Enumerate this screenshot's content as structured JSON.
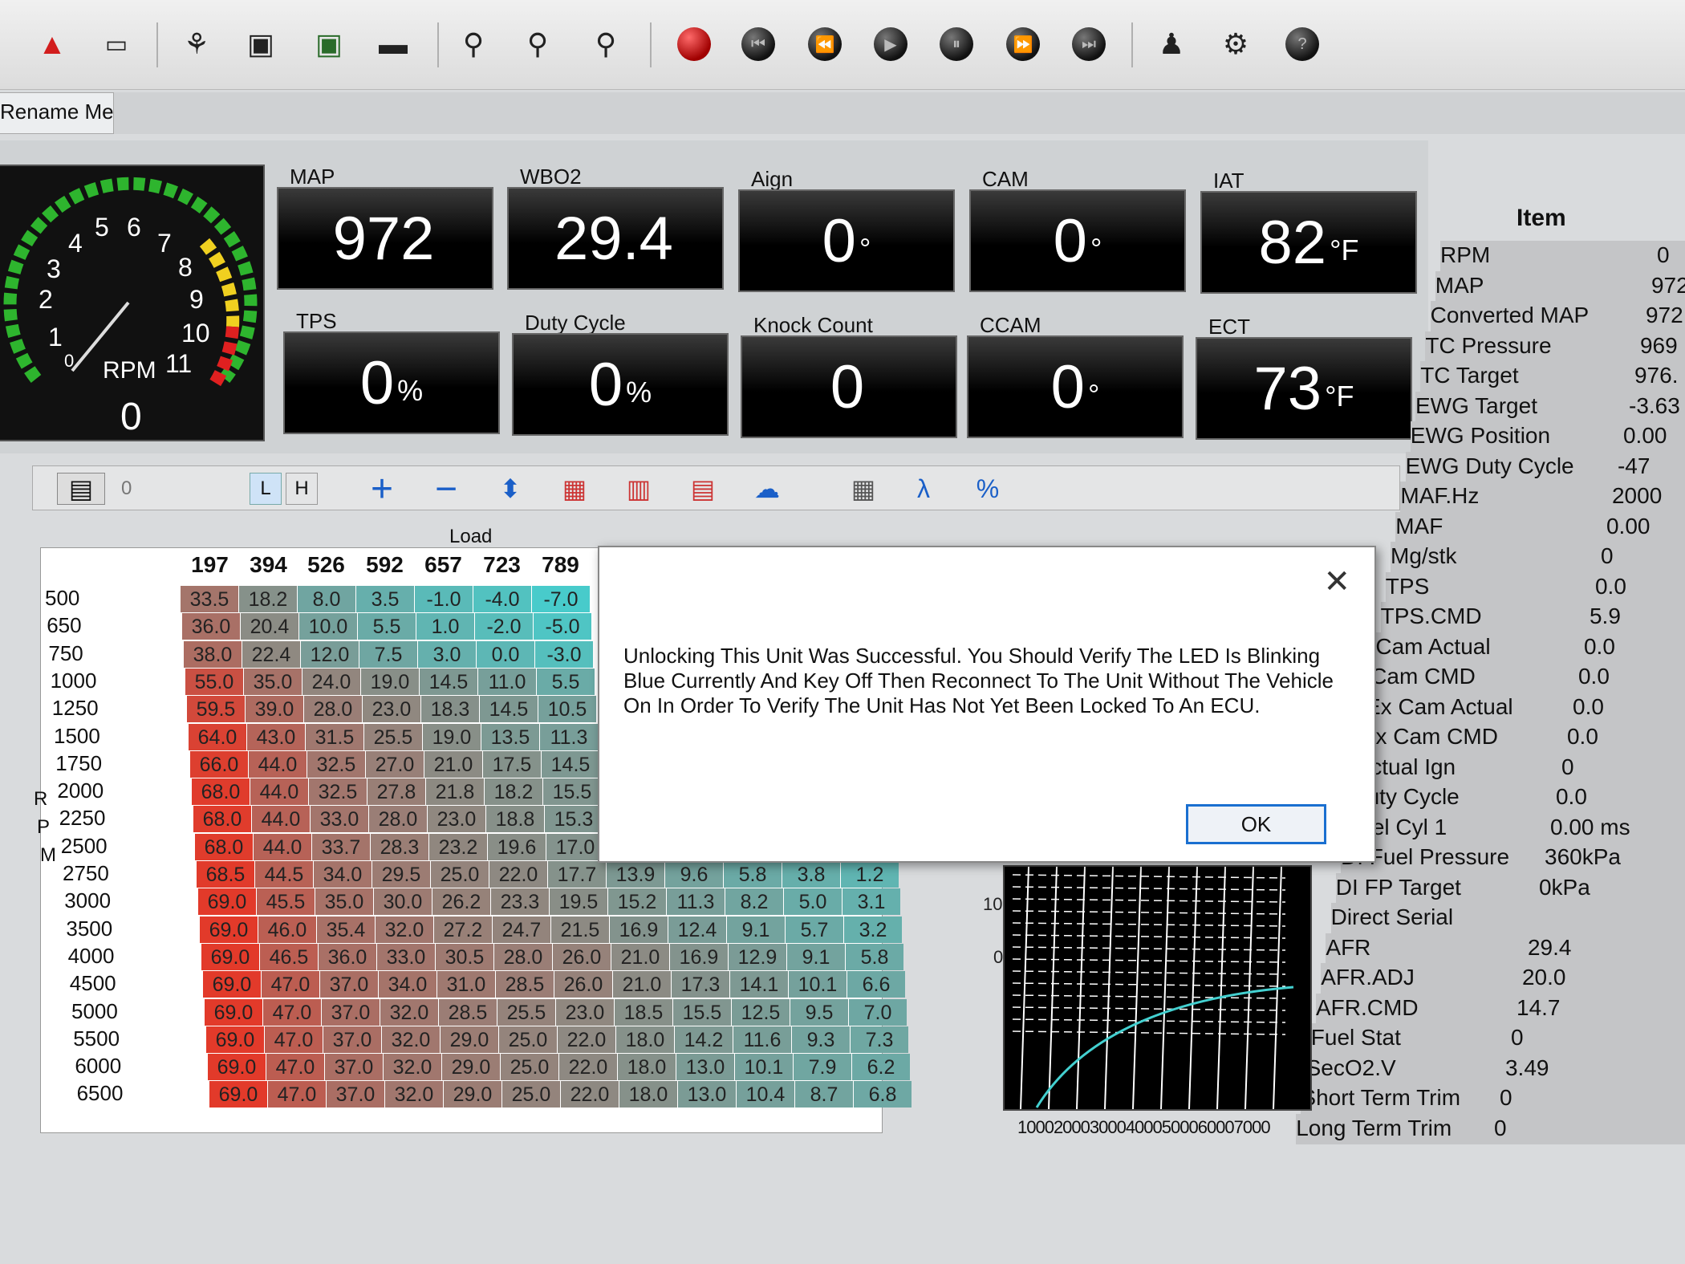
{
  "tab": {
    "label": "Rename Me"
  },
  "gauge": {
    "label": "RPM",
    "value": "0",
    "ticks": [
      "0",
      "1",
      "2",
      "3",
      "4",
      "5",
      "6",
      "7",
      "8",
      "9",
      "10",
      "11"
    ]
  },
  "panels": [
    {
      "id": "map",
      "label": "MAP",
      "value": "972",
      "unit": ""
    },
    {
      "id": "wbo2",
      "label": "WBO2",
      "value": "29.4",
      "unit": ""
    },
    {
      "id": "aign",
      "label": "Aign",
      "value": "0",
      "unit": "°"
    },
    {
      "id": "cam",
      "label": "CAM",
      "value": "0",
      "unit": "°"
    },
    {
      "id": "iat",
      "label": "IAT",
      "value": "82",
      "unit": "°F"
    },
    {
      "id": "tps",
      "label": "TPS",
      "value": "0",
      "unit": "%"
    },
    {
      "id": "duty",
      "label": "Duty Cycle",
      "value": "0",
      "unit": "%"
    },
    {
      "id": "knock",
      "label": "Knock Count",
      "value": "0",
      "unit": ""
    },
    {
      "id": "ccam",
      "label": "CCAM",
      "value": "0",
      "unit": "°"
    },
    {
      "id": "ect",
      "label": "ECT",
      "value": "73",
      "unit": "°F"
    }
  ],
  "table_toolbar": {
    "value": "0",
    "l_label": "L",
    "h_label": "H"
  },
  "table": {
    "load_label": "Load",
    "axis_label": [
      "R",
      "P",
      "M"
    ],
    "load_headers": [
      "197",
      "394",
      "526",
      "592",
      "657",
      "723",
      "789"
    ],
    "rpm": [
      "500",
      "650",
      "750",
      "1000",
      "1250",
      "1500",
      "1750",
      "2000",
      "2250",
      "2500",
      "2750",
      "3000",
      "3500",
      "4000",
      "4500",
      "5000",
      "5500",
      "6000",
      "6500"
    ],
    "rows": [
      [
        "33.5",
        "18.2",
        "8.0",
        "3.5",
        "-1.0",
        "-4.0",
        "-7.0"
      ],
      [
        "36.0",
        "20.4",
        "10.0",
        "5.5",
        "1.0",
        "-2.0",
        "-5.0"
      ],
      [
        "38.0",
        "22.4",
        "12.0",
        "7.5",
        "3.0",
        "0.0",
        "-3.0"
      ],
      [
        "55.0",
        "35.0",
        "24.0",
        "19.0",
        "14.5",
        "11.0",
        "5.5"
      ],
      [
        "59.5",
        "39.0",
        "28.0",
        "23.0",
        "18.3",
        "14.5",
        "10.5"
      ],
      [
        "64.0",
        "43.0",
        "31.5",
        "25.5",
        "19.0",
        "13.5",
        "11.3"
      ],
      [
        "66.0",
        "44.0",
        "32.5",
        "27.0",
        "21.0",
        "17.5",
        "14.5"
      ],
      [
        "68.0",
        "44.0",
        "32.5",
        "27.8",
        "21.8",
        "18.2",
        "15.5"
      ],
      [
        "68.0",
        "44.0",
        "33.0",
        "28.0",
        "23.0",
        "18.8",
        "15.3"
      ],
      [
        "68.0",
        "44.0",
        "33.7",
        "28.3",
        "23.2",
        "19.6",
        "17.0"
      ],
      [
        "68.5",
        "44.5",
        "34.0",
        "29.5",
        "25.0",
        "22.0",
        "17.7",
        "13.9",
        "9.6",
        "5.8",
        "3.8",
        "1.2"
      ],
      [
        "69.0",
        "45.5",
        "35.0",
        "30.0",
        "26.2",
        "23.3",
        "19.5",
        "15.2",
        "11.3",
        "8.2",
        "5.0",
        "3.1"
      ],
      [
        "69.0",
        "46.0",
        "35.4",
        "32.0",
        "27.2",
        "24.7",
        "21.5",
        "16.9",
        "12.4",
        "9.1",
        "5.7",
        "3.2"
      ],
      [
        "69.0",
        "46.5",
        "36.0",
        "33.0",
        "30.5",
        "28.0",
        "26.0",
        "21.0",
        "16.9",
        "12.9",
        "9.1",
        "5.8"
      ],
      [
        "69.0",
        "47.0",
        "37.0",
        "34.0",
        "31.0",
        "28.5",
        "26.0",
        "21.0",
        "17.3",
        "14.1",
        "10.1",
        "6.6"
      ],
      [
        "69.0",
        "47.0",
        "37.0",
        "32.0",
        "28.5",
        "25.5",
        "23.0",
        "18.5",
        "15.5",
        "12.5",
        "9.5",
        "7.0"
      ],
      [
        "69.0",
        "47.0",
        "37.0",
        "32.0",
        "29.0",
        "25.0",
        "22.0",
        "18.0",
        "14.2",
        "11.6",
        "9.3",
        "7.3"
      ],
      [
        "69.0",
        "47.0",
        "37.0",
        "32.0",
        "29.0",
        "25.0",
        "22.0",
        "18.0",
        "13.0",
        "10.1",
        "7.9",
        "6.2"
      ],
      [
        "69.0",
        "47.0",
        "37.0",
        "32.0",
        "29.0",
        "25.0",
        "22.0",
        "18.0",
        "13.0",
        "10.4",
        "8.7",
        "6.8"
      ]
    ]
  },
  "dialog": {
    "message": "Unlocking This Unit Was Successful. You Should Verify The LED Is Blinking Blue Currently And Key Off Then Reconnect To The Unit Without The Vehicle On In Order To Verify The Unit Has Not Yet Been Locked To An ECU.",
    "ok_label": "OK",
    "close_label": "✕"
  },
  "plot": {
    "y_labels": [
      "10",
      "0"
    ],
    "x_labels": "1000200030004000500060007000"
  },
  "items": {
    "header": "Item",
    "rows": [
      [
        "RPM",
        "0"
      ],
      [
        "MAP",
        "972"
      ],
      [
        "Converted MAP",
        "972"
      ],
      [
        "TC Pressure",
        "969"
      ],
      [
        "TC Target",
        "976."
      ],
      [
        "EWG Target",
        "-3.63"
      ],
      [
        "EWG Position",
        "0.00"
      ],
      [
        "EWG Duty Cycle",
        "-47"
      ],
      [
        "MAF.Hz",
        "2000"
      ],
      [
        "MAF",
        "0.00"
      ],
      [
        "Mg/stk",
        "0"
      ],
      [
        "TPS",
        "0.0"
      ],
      [
        "TPS.CMD",
        "5.9"
      ],
      [
        "Cam Actual",
        "0.0"
      ],
      [
        "Cam CMD",
        "0.0"
      ],
      [
        "Ex Cam Actual",
        "0.0"
      ],
      [
        "Ex Cam CMD",
        "0.0"
      ],
      [
        "Actual Ign",
        "0"
      ],
      [
        "Duty Cycle",
        "0.0"
      ],
      [
        "Fuel Cyl 1",
        "0.00 ms"
      ],
      [
        "DI Fuel Pressure",
        "360kPa"
      ],
      [
        "DI FP Target",
        "0kPa"
      ],
      [
        "Direct Serial",
        ""
      ],
      [
        "AFR",
        "29.4"
      ],
      [
        "AFR.ADJ",
        "20.0"
      ],
      [
        "AFR.CMD",
        "14.7"
      ],
      [
        "Fuel Stat",
        "0"
      ],
      [
        "SecO2.V",
        "3.49"
      ],
      [
        "Short Term Trim",
        "0"
      ],
      [
        "Long Term Trim",
        "0"
      ]
    ]
  },
  "colors": {
    "hot": "#e23a2a",
    "cool": "#43d0d0",
    "ok_border": "#1a6fd0"
  }
}
